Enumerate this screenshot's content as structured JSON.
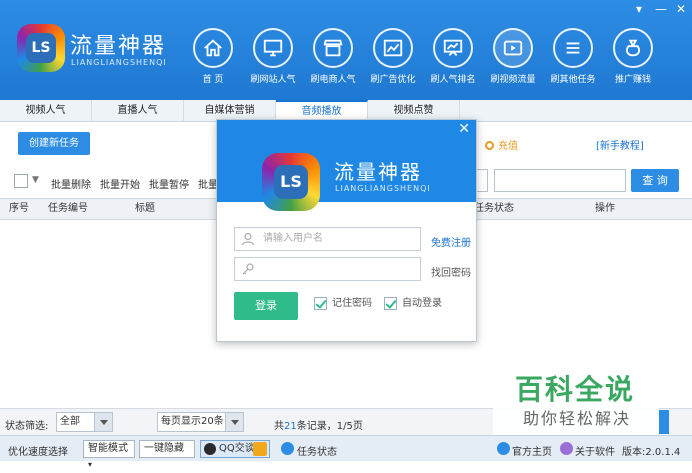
{
  "window": {
    "minimize": "▾",
    "maximize": "—",
    "close": "✕"
  },
  "logo": {
    "mark": "LS",
    "title": "流量神器",
    "subtitle": "LIANGLIANGSHENQI"
  },
  "nav": [
    {
      "label": "首 页",
      "icon": "home-icon"
    },
    {
      "label": "刷网站人气",
      "icon": "monitor-icon"
    },
    {
      "label": "刷电商人气",
      "icon": "store-icon"
    },
    {
      "label": "刷广告优化",
      "icon": "ad-chart-icon"
    },
    {
      "label": "刷人气排名",
      "icon": "ranking-board-icon"
    },
    {
      "label": "刷视频流量",
      "icon": "video-icon"
    },
    {
      "label": "刷其他任务",
      "icon": "list-icon"
    },
    {
      "label": "推广赚钱",
      "icon": "money-bag-icon"
    }
  ],
  "tabs": [
    "视频人气",
    "直播人气",
    "自媒体营销",
    "音频播放",
    "视频点赞"
  ],
  "actions": {
    "create_task": "创建新任务",
    "recharge": "充值",
    "tutorial": "[新手教程]"
  },
  "toolbar": {
    "batch_delete": "批量删除",
    "batch_start": "批量开始",
    "batch_pause": "批量暂停",
    "batch_more": "批量",
    "query": "查 询"
  },
  "table": {
    "columns": [
      "序号",
      "任务编号",
      "标题",
      "任务状态",
      "操作"
    ]
  },
  "footer": {
    "status_filter_label": "状态筛选:",
    "status_filter_value": "全部",
    "per_page_value": "每页显示20条",
    "records_prefix": "共",
    "records_count": "21",
    "records_suffix": "条记录，1/5页"
  },
  "statusbar": {
    "speed_label": "优化速度选择",
    "speed_value": "智能模式",
    "one_key_hide": "一键隐藏",
    "qq_chat": "QQ交谈",
    "task_status": "任务状态",
    "official_site": "官方主页",
    "about": "关于软件",
    "version": "版本:2.0.1.4"
  },
  "login": {
    "close": "✕",
    "username_placeholder": "请输入用户名",
    "register": "免费注册",
    "password_placeholder": "",
    "find_password": "找回密码",
    "login_button": "登录",
    "remember_password": "记住密码",
    "auto_login": "自动登录"
  },
  "watermark": {
    "title": "百科全说",
    "subtitle": "助你轻松解决"
  },
  "colors": {
    "primary": "#2d8de4",
    "login_green": "#2fbb8a",
    "recharge_orange": "#e89a1f",
    "watermark_green": "#3aa861"
  }
}
